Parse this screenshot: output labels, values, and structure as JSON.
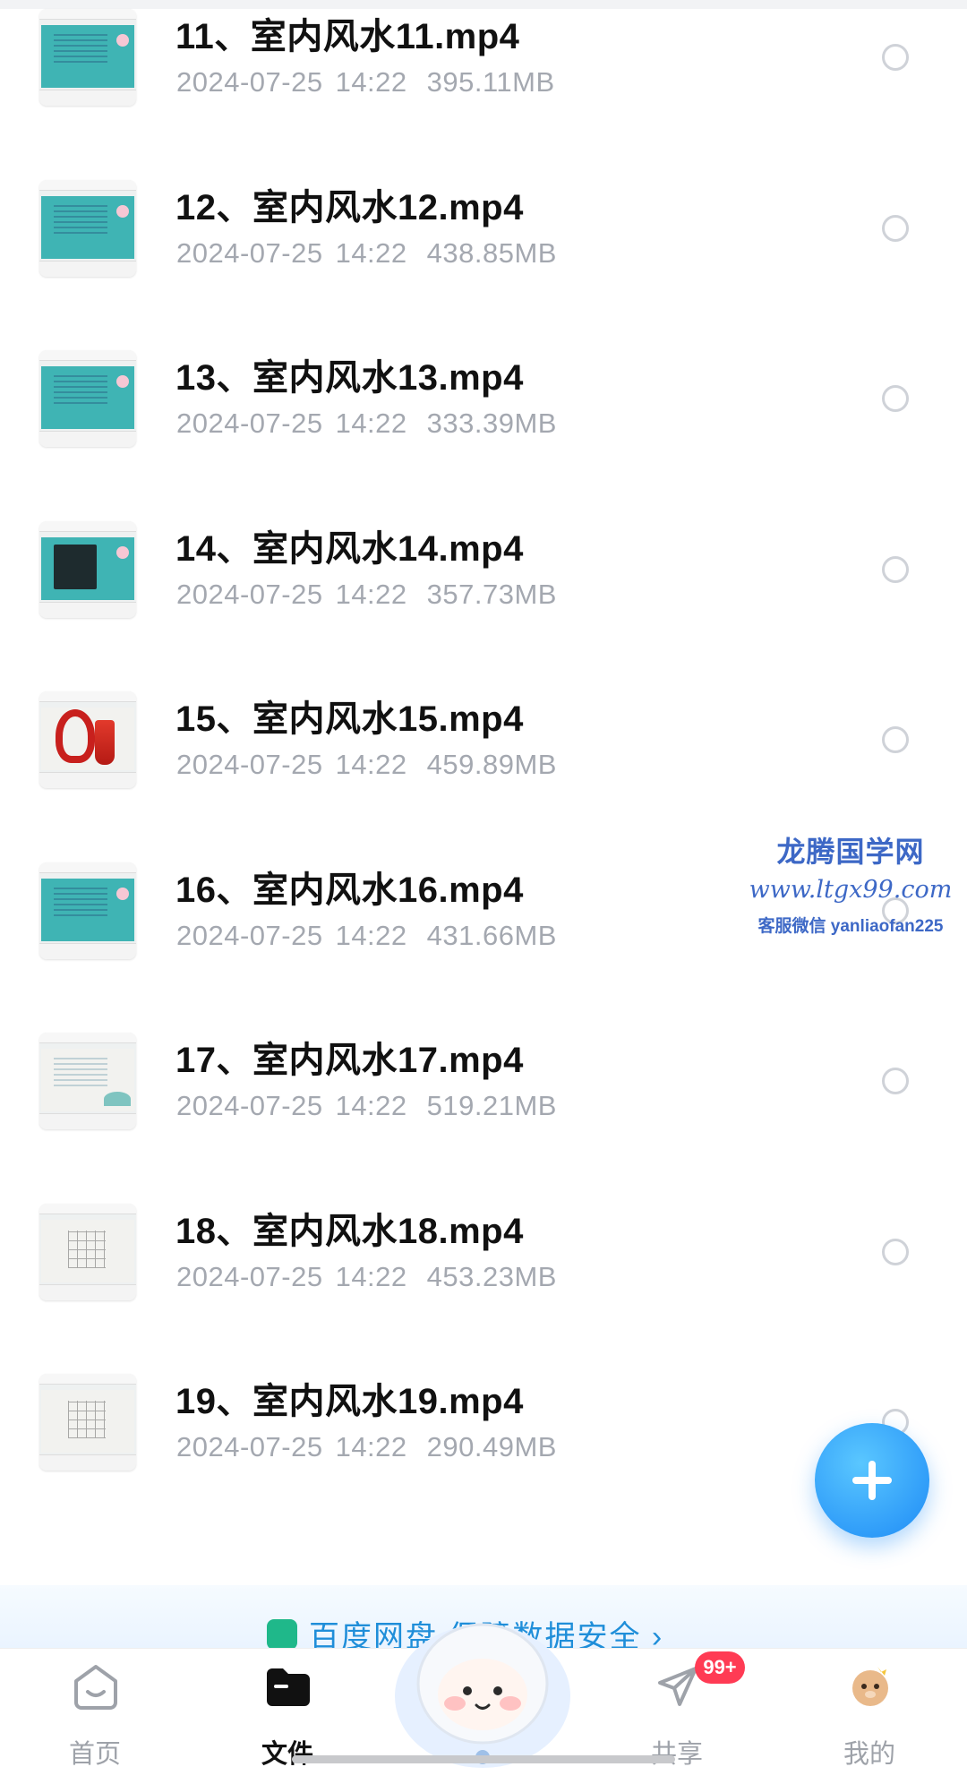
{
  "files": [
    {
      "name": "11、室内风水11.mp4",
      "date": "2024-07-25",
      "time": "14:22",
      "size": "395.11MB",
      "thumb": "teal-text"
    },
    {
      "name": "12、室内风水12.mp4",
      "date": "2024-07-25",
      "time": "14:22",
      "size": "438.85MB",
      "thumb": "teal-text"
    },
    {
      "name": "13、室内风水13.mp4",
      "date": "2024-07-25",
      "time": "14:22",
      "size": "333.39MB",
      "thumb": "teal-text"
    },
    {
      "name": "14、室内风水14.mp4",
      "date": "2024-07-25",
      "time": "14:22",
      "size": "357.73MB",
      "thumb": "teal-photo"
    },
    {
      "name": "15、室内风水15.mp4",
      "date": "2024-07-25",
      "time": "14:22",
      "size": "459.89MB",
      "thumb": "red-knot"
    },
    {
      "name": "16、室内风水16.mp4",
      "date": "2024-07-25",
      "time": "14:22",
      "size": "431.66MB",
      "thumb": "teal-text"
    },
    {
      "name": "17、室内风水17.mp4",
      "date": "2024-07-25",
      "time": "14:22",
      "size": "519.21MB",
      "thumb": "light-landscape"
    },
    {
      "name": "18、室内风水18.mp4",
      "date": "2024-07-25",
      "time": "14:22",
      "size": "453.23MB",
      "thumb": "light-grid"
    },
    {
      "name": "19、室内风水19.mp4",
      "date": "2024-07-25",
      "time": "14:22",
      "size": "290.49MB",
      "thumb": "light-grid"
    }
  ],
  "watermark": {
    "title": "龙腾国学网",
    "url": "www.ltgx99.com",
    "contact": "客服微信 yanliaofan225"
  },
  "fab": {
    "icon": "plus-icon",
    "color": "#1e8bf6"
  },
  "banner": {
    "text": "百度网盘 保障数据安全 ›"
  },
  "tabbar": {
    "tabs": [
      {
        "label": "首页",
        "icon": "home-icon",
        "active": false
      },
      {
        "label": "文件",
        "icon": "folder-icon",
        "active": true
      },
      {
        "label": "共享",
        "icon": "send-icon",
        "active": false
      },
      {
        "label": "我的",
        "icon": "profile-avatar-icon",
        "active": false
      }
    ],
    "share_badge": "99+",
    "center_icon": "mascot-icon"
  },
  "colors": {
    "accent": "#1e8bf6",
    "badge": "#ff3b54",
    "meta_text": "#a4a8b0"
  }
}
